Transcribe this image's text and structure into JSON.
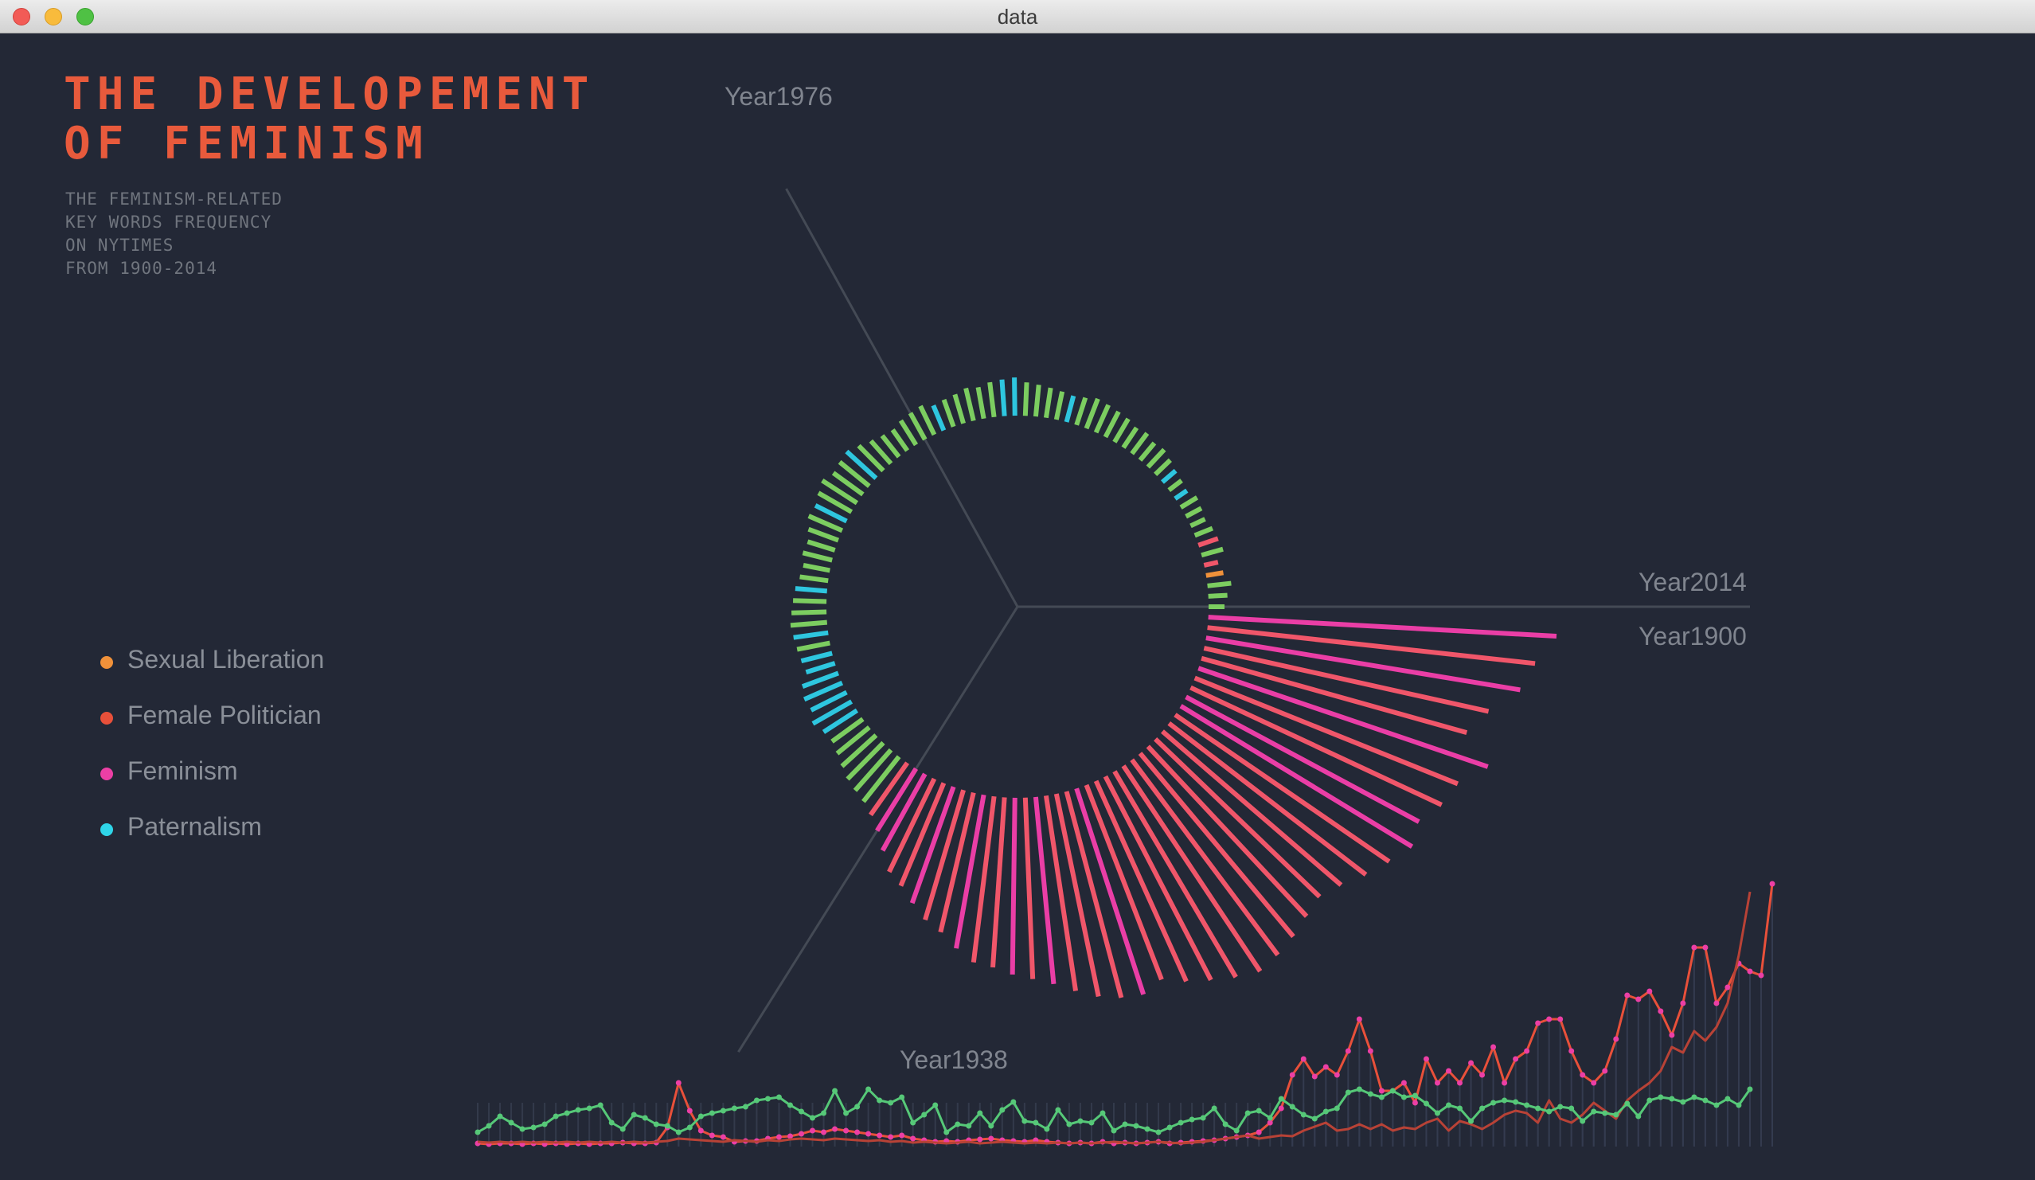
{
  "window": {
    "title": "data"
  },
  "header": {
    "title_lines": [
      "THE DEVELOPEMENT",
      "OF FEMINISM"
    ],
    "subtitle_lines": [
      "THE FEMINISM-RELATED",
      "KEY WORDS FREQUENCY",
      "ON NYTIMES",
      "FROM 1900-2014"
    ]
  },
  "legend": [
    {
      "label": "Sexual Liberation",
      "color": "#f0913a"
    },
    {
      "label": "Female Politician",
      "color": "#e8503a"
    },
    {
      "label": "Feminism",
      "color": "#ec3fa5"
    },
    {
      "label": "Paternalism",
      "color": "#2fd5e8"
    }
  ],
  "chart_data": {
    "type": "radial-bar-with-line",
    "year_start": 1900,
    "year_end": 2014,
    "axis_labels": [
      "Year1900",
      "Year1938",
      "Year1976",
      "Year2014"
    ],
    "radial": {
      "values_by_year": [
        20,
        24,
        30,
        22,
        18,
        28,
        26,
        24,
        20,
        22,
        24,
        18,
        20,
        22,
        26,
        30,
        28,
        32,
        30,
        34,
        36,
        38,
        40,
        36,
        34,
        36,
        38,
        40,
        42,
        48,
        46,
        44,
        40,
        42,
        38,
        36,
        34,
        40,
        38,
        36,
        32,
        34,
        38,
        44,
        50,
        48,
        46,
        52,
        48,
        44,
        46,
        40,
        36,
        38,
        34,
        36,
        40,
        42,
        44,
        46,
        44,
        42,
        40,
        38,
        48,
        52,
        50,
        56,
        50,
        48,
        52,
        58,
        64,
        68,
        72,
        80,
        92,
        110,
        130,
        140,
        155,
        170,
        180,
        196,
        210,
        214,
        222,
        228,
        236,
        248,
        260,
        268,
        272,
        262,
        276,
        288,
        300,
        310,
        306,
        300,
        292,
        286,
        296,
        312,
        326,
        340,
        332,
        348,
        356,
        384,
        346,
        366,
        400,
        414,
        438
      ],
      "color_by_year": [
        "green",
        "green",
        "green",
        "orange",
        "red",
        "green",
        "red",
        "green",
        "green",
        "green",
        "green",
        "cyan",
        "green",
        "cyan",
        "green",
        "green",
        "green",
        "green",
        "green",
        "green",
        "green",
        "green",
        "green",
        "green",
        "cyan",
        "green",
        "green",
        "green",
        "green",
        "cyan",
        "cyan",
        "green",
        "green",
        "green",
        "green",
        "green",
        "cyan",
        "green",
        "green",
        "green",
        "green",
        "green",
        "green",
        "green",
        "cyan",
        "green",
        "green",
        "green",
        "green",
        "cyan",
        "green",
        "green",
        "green",
        "green",
        "green",
        "green",
        "cyan",
        "green",
        "green",
        "green",
        "cyan",
        "green",
        "cyan",
        "cyan",
        "cyan",
        "cyan",
        "cyan",
        "cyan",
        "cyan",
        "green",
        "green",
        "green",
        "green",
        "green",
        "green",
        "red",
        "pink",
        "pink",
        "red",
        "red",
        "pink",
        "red",
        "red",
        "pink",
        "red",
        "red",
        "pink",
        "red",
        "pink",
        "red",
        "red",
        "red",
        "pink",
        "red",
        "red",
        "red",
        "red",
        "red",
        "red",
        "red",
        "red",
        "red",
        "red",
        "red",
        "red",
        "pink",
        "pink",
        "red",
        "red",
        "pink",
        "red",
        "red",
        "pink",
        "red",
        "pink",
        "pink",
        "pink"
      ]
    },
    "series": [
      {
        "name": "Feminism",
        "color": "#e8503a",
        "marker_color": "#ec3fa5",
        "values": [
          4,
          3,
          4,
          4,
          3,
          4,
          3,
          4,
          3,
          4,
          3,
          4,
          4,
          5,
          4,
          4,
          5,
          24,
          80,
          45,
          20,
          14,
          12,
          6,
          7,
          7,
          10,
          12,
          13,
          16,
          20,
          18,
          22,
          20,
          18,
          16,
          14,
          12,
          14,
          10,
          8,
          6,
          7,
          6,
          8,
          9,
          10,
          8,
          7,
          6,
          8,
          6,
          5,
          4,
          5,
          4,
          6,
          4,
          5,
          4,
          5,
          6,
          4,
          5,
          6,
          7,
          8,
          10,
          12,
          14,
          18,
          30,
          48,
          90,
          110,
          88,
          100,
          90,
          120,
          160,
          120,
          70,
          70,
          80,
          55,
          110,
          80,
          95,
          80,
          105,
          90,
          125,
          80,
          110,
          120,
          155,
          160,
          160,
          120,
          90,
          80,
          95,
          135,
          190,
          185,
          195,
          170,
          140,
          180,
          250,
          250,
          180,
          200,
          230,
          220,
          215,
          330
        ]
      },
      {
        "name": "Female Politician",
        "color": "#b84236",
        "values": [
          6,
          5,
          6,
          5,
          6,
          5,
          6,
          5,
          6,
          5,
          6,
          5,
          6,
          5,
          6,
          5,
          6,
          7,
          10,
          9,
          8,
          7,
          6,
          8,
          7,
          6,
          8,
          7,
          9,
          10,
          9,
          8,
          10,
          9,
          8,
          7,
          8,
          6,
          7,
          5,
          6,
          5,
          4,
          5,
          6,
          4,
          5,
          6,
          5,
          4,
          5,
          4,
          5,
          4,
          5,
          4,
          5,
          6,
          5,
          4,
          5,
          6,
          5,
          4,
          5,
          6,
          8,
          10,
          12,
          14,
          10,
          12,
          14,
          13,
          20,
          25,
          30,
          20,
          22,
          28,
          22,
          28,
          20,
          24,
          22,
          30,
          35,
          20,
          32,
          28,
          22,
          30,
          40,
          45,
          42,
          30,
          58,
          35,
          30,
          40,
          55,
          45,
          35,
          58,
          70,
          80,
          95,
          125,
          118,
          145,
          133,
          150,
          180,
          240,
          320
        ]
      },
      {
        "name": "Paternalism",
        "color": "#56c878",
        "marker_color": "#56c878",
        "values": [
          18,
          26,
          38,
          30,
          22,
          24,
          28,
          38,
          42,
          46,
          48,
          52,
          30,
          22,
          40,
          36,
          28,
          26,
          18,
          24,
          38,
          42,
          45,
          48,
          50,
          58,
          60,
          62,
          52,
          44,
          36,
          42,
          70,
          42,
          50,
          72,
          58,
          55,
          62,
          30,
          40,
          52,
          18,
          28,
          26,
          42,
          26,
          46,
          56,
          32,
          30,
          22,
          46,
          28,
          32,
          30,
          42,
          20,
          28,
          26,
          22,
          18,
          24,
          30,
          34,
          36,
          48,
          28,
          20,
          42,
          45,
          36,
          60,
          50,
          40,
          35,
          44,
          48,
          68,
          72,
          66,
          62,
          70,
          62,
          64,
          54,
          42,
          52,
          48,
          32,
          48,
          55,
          58,
          56,
          52,
          48,
          44,
          50,
          48,
          32,
          44,
          42,
          40,
          54,
          38,
          58,
          62,
          60,
          56,
          62,
          58,
          52,
          60,
          52,
          72
        ]
      }
    ]
  }
}
